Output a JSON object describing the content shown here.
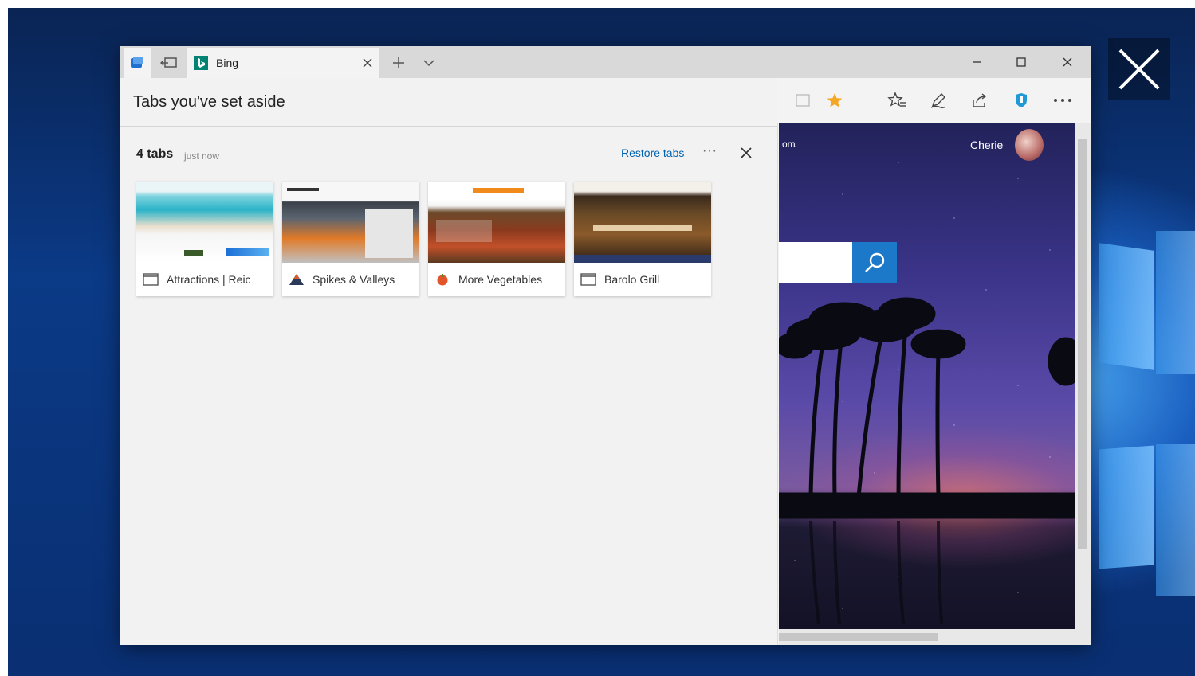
{
  "browser": {
    "tab": {
      "title": "Bing"
    }
  },
  "panel": {
    "title": "Tabs you've set aside",
    "group": {
      "count_label": "4 tabs",
      "time_label": "just now",
      "restore_label": "Restore tabs",
      "more_label": "···"
    },
    "cards": [
      {
        "label": "Attractions | Reic"
      },
      {
        "label": "Spikes & Valleys"
      },
      {
        "label": "More Vegetables"
      },
      {
        "label": "Barolo Grill"
      }
    ]
  },
  "page": {
    "user_name": "Cherie",
    "edge_text": "om"
  },
  "colors": {
    "accent": "#0063b1",
    "search_button": "#1c78c8",
    "favorite_star": "#f5a623"
  }
}
